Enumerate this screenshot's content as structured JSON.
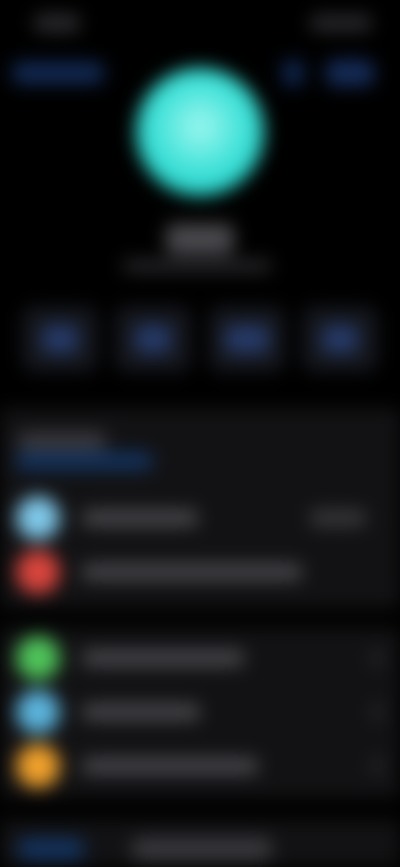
{
  "status_bar": {
    "time": "",
    "icons": ""
  },
  "nav": {
    "back_label": "",
    "edit_label": ""
  },
  "contact": {
    "name": "",
    "subtitle": ""
  },
  "actions": [
    {
      "label": "",
      "icon": "message-icon"
    },
    {
      "label": "",
      "icon": "phone-icon"
    },
    {
      "label": "",
      "icon": "video-icon"
    },
    {
      "label": "",
      "icon": "mail-icon"
    }
  ],
  "section1": {
    "header": "",
    "link": "",
    "rows": [
      {
        "label": "",
        "badge": "",
        "icon_color": "#7fc7e8"
      },
      {
        "label": "",
        "icon_color": "#d8453d"
      }
    ]
  },
  "section2": {
    "rows": [
      {
        "label": "",
        "icon_color": "#4fc35a"
      },
      {
        "label": "",
        "icon_color": "#5bb3db"
      },
      {
        "label": "",
        "icon_color": "#f0a12c"
      }
    ]
  },
  "section3": {
    "label": ""
  },
  "colors": {
    "avatar": "#45e3da",
    "accent": "#0a84ff",
    "background": "#000000",
    "group_background": "#121214"
  }
}
